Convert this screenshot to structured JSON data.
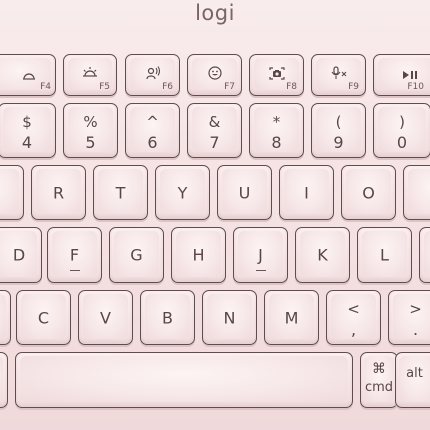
{
  "brand": "logi",
  "function_row": [
    {
      "name": "brightness-down-key",
      "icon": "brightness-down-icon",
      "fn": "F4"
    },
    {
      "name": "brightness-up-key",
      "icon": "brightness-up-icon",
      "fn": "F5"
    },
    {
      "name": "dictation-key",
      "icon": "dictation-icon",
      "fn": "F6"
    },
    {
      "name": "emoji-key",
      "icon": "emoji-icon",
      "fn": "F7"
    },
    {
      "name": "screenshot-key",
      "icon": "screenshot-icon",
      "fn": "F8"
    },
    {
      "name": "mic-mute-key",
      "icon": "mic-mute-icon",
      "fn": "F9"
    },
    {
      "name": "play-pause-key",
      "icon": "play-pause-icon",
      "fn": "F10"
    }
  ],
  "number_row": [
    {
      "top": "$",
      "bottom": "4"
    },
    {
      "top": "%",
      "bottom": "5"
    },
    {
      "top": "^",
      "bottom": "6"
    },
    {
      "top": "&",
      "bottom": "7"
    },
    {
      "top": "*",
      "bottom": "8"
    },
    {
      "top": "(",
      "bottom": "9"
    },
    {
      "top": ")",
      "bottom": "0"
    }
  ],
  "letter_rows": {
    "row1": [
      "R",
      "T",
      "Y",
      "U",
      "I",
      "O"
    ],
    "row2": [
      "D",
      "F",
      "G",
      "H",
      "J",
      "K",
      "L"
    ],
    "row3": [
      "C",
      "V",
      "B",
      "N",
      "M"
    ]
  },
  "punct_row3": [
    {
      "top": "<",
      "bottom": ","
    },
    {
      "top": ">",
      "bottom": "."
    }
  ],
  "bottom_row": {
    "cmd_symbol": "⌘",
    "cmd_label": "cmd",
    "alt_label": "alt"
  },
  "colors": {
    "key_rose": "#f5e2e3",
    "legend": "#5a4648",
    "outline": "#5f4c4e"
  }
}
